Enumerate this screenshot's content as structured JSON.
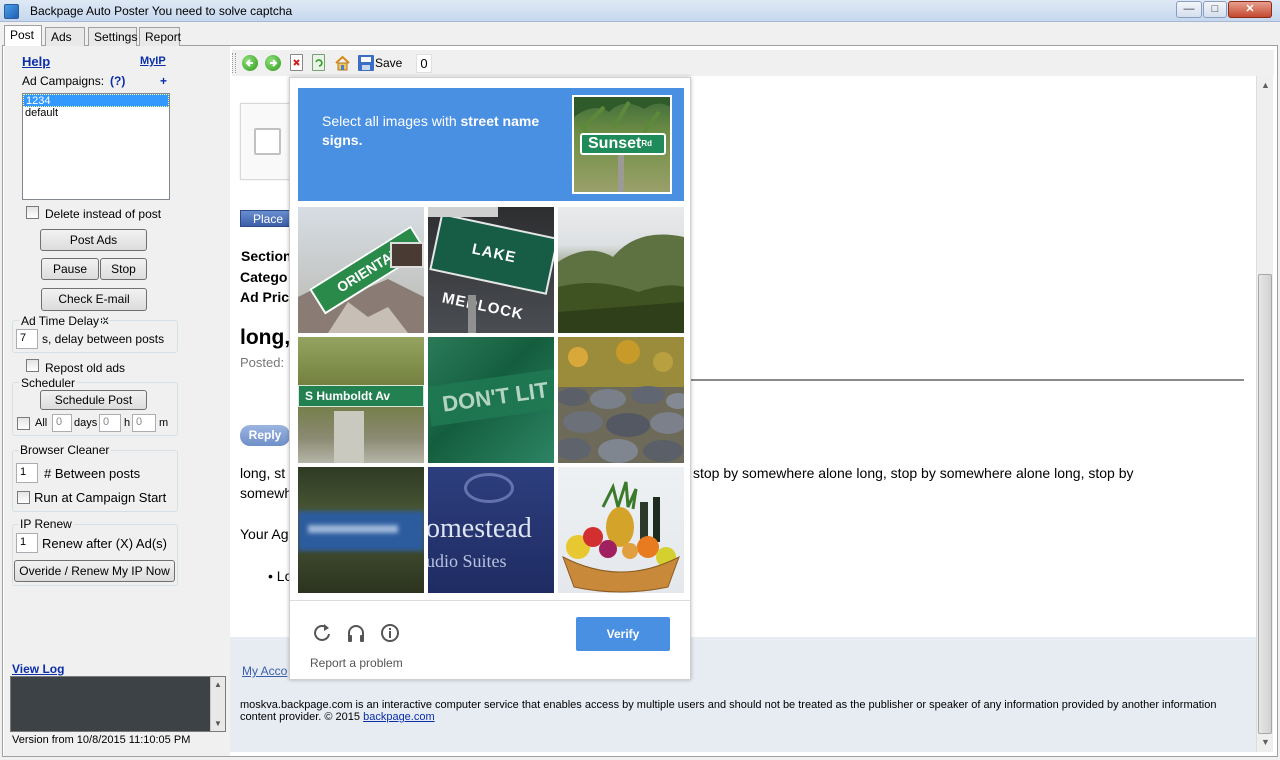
{
  "window": {
    "title": "Backpage Auto Poster You need to solve captcha",
    "min_glyph": "—",
    "max_glyph": "□",
    "close_glyph": "✕"
  },
  "tabs": [
    "Post",
    "Ads",
    "Settings",
    "Report"
  ],
  "left": {
    "help": "Help",
    "myip": "MyIP",
    "campaigns_label": "Ad Campaigns:",
    "campaigns_help": "(?)",
    "campaigns_add": "+",
    "campaigns": [
      "1234",
      "default"
    ],
    "delete_instead": "Delete instead of post",
    "post_ads": "Post Ads",
    "pause": "Pause",
    "stop": "Stop",
    "check_email": "Check E-mail Inbox",
    "ad_time_delay": "Ad Time Delay",
    "delay_value": "7",
    "delay_label": "s, delay between posts",
    "repost_old": "Repost old ads",
    "scheduler": "Scheduler",
    "schedule_post": "Schedule Post",
    "all": "All",
    "days_value": "0",
    "days": "days",
    "hours_value": "0",
    "hours": "h",
    "minutes_value": "0",
    "minutes": "m",
    "browser_cleaner": "Browser Cleaner",
    "between_value": "1",
    "between_label": "# Between posts",
    "run_at_start": "Run at Campaign Start",
    "ip_renew": "IP Renew",
    "renew_value": "1",
    "renew_label": "Renew after (X) Ad(s)",
    "override_renew": "Overide / Renew My IP Now",
    "view_log": "View Log",
    "version": "Version from 10/8/2015 11:10:05 PM"
  },
  "toolbar": {
    "icons": [
      "back-arrow-icon",
      "forward-arrow-icon",
      "stop-icon",
      "refresh-icon",
      "home-icon",
      "save-icon"
    ],
    "save": "Save",
    "counter": "0"
  },
  "page": {
    "place_ad": "Place A",
    "section": "Section",
    "category": "Catego",
    "ad_price": "Ad Pric",
    "ad_title": "long,",
    "posted": "Posted:",
    "reply": "Reply",
    "body_left_1": "long, st",
    "body_right_1": "stop by somewhere alone long, stop by somewhere alone long, stop by",
    "body_left_2": "somewh",
    "your_ad": "Your Ag",
    "bullet": "• Lo",
    "my_account": "My Acco",
    "footer_text": "moskva.backpage.com is an interactive computer service that enables access by multiple users and should not be treated as the publisher or speaker of any information provided by another information content provider. © 2015",
    "footer_link": "backpage.com"
  },
  "captcha": {
    "prompt_plain": "Select all images with",
    "prompt_bold": "street name signs.",
    "sample_sign": "Sunset",
    "sample_sign_suffix": "Rd",
    "tiles": [
      {
        "kind": "street-sign",
        "text": "ORIENTAL"
      },
      {
        "kind": "street-sign",
        "text": "LAKE MEDLOCK"
      },
      {
        "kind": "mountains"
      },
      {
        "kind": "street-sign",
        "text": "S Humboldt Av"
      },
      {
        "kind": "street-sign",
        "text": "DON'T LIT"
      },
      {
        "kind": "rocks"
      },
      {
        "kind": "blurry-sign"
      },
      {
        "kind": "hotel-sign",
        "text": "omestead",
        "text2": "udio Suites"
      },
      {
        "kind": "fruit-basket"
      }
    ],
    "report_problem": "Report a problem",
    "verify": "Verify",
    "footer_icons": [
      "reload-icon",
      "headphones-icon",
      "info-icon"
    ]
  }
}
